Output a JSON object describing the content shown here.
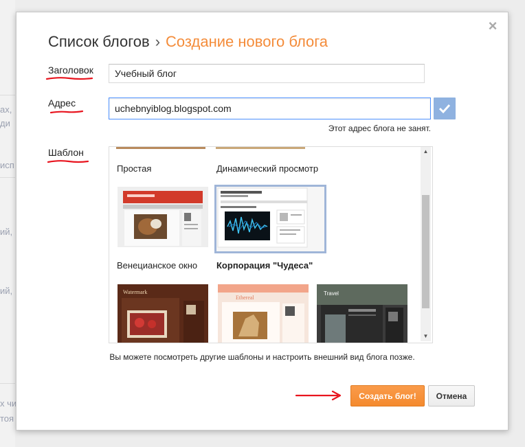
{
  "background": {
    "fragments": [
      "ах,",
      "ди",
      "исп",
      "ий,",
      "ий,",
      "х чи",
      "тоя"
    ]
  },
  "dialog": {
    "breadcrumb_parent": "Список блогов",
    "breadcrumb_separator": "›",
    "breadcrumb_current": "Создание нового блога",
    "close_label": "×",
    "title_field": {
      "label": "Заголовок",
      "value": "Учебный блог"
    },
    "address_field": {
      "label": "Адрес",
      "value": "uchebnyiblog.blogspot.com",
      "hint": "Этот адрес блога не занят."
    },
    "template_label": "Шаблон",
    "templates": [
      {
        "name": "Простая",
        "selected": false
      },
      {
        "name": "Динамический просмотр",
        "selected": true
      },
      {
        "name": "Венецианское окно",
        "selected": false
      },
      {
        "name": "Корпорация \"Чудеса\"",
        "selected": false
      },
      {
        "name": "Watermark",
        "selected": false
      },
      {
        "name": "Ethereal",
        "selected": false
      },
      {
        "name": "Travel",
        "selected": false
      }
    ],
    "footnote": "Вы можете посмотреть другие шаблоны и настроить внешний вид блога позже.",
    "create_button": "Создать блог!",
    "cancel_button": "Отмена"
  },
  "colors": {
    "accent_orange": "#f48c3a",
    "annotation_red": "#e8141e",
    "selection_blue": "#9fb5d8",
    "check_button": "#8fb2e0"
  }
}
